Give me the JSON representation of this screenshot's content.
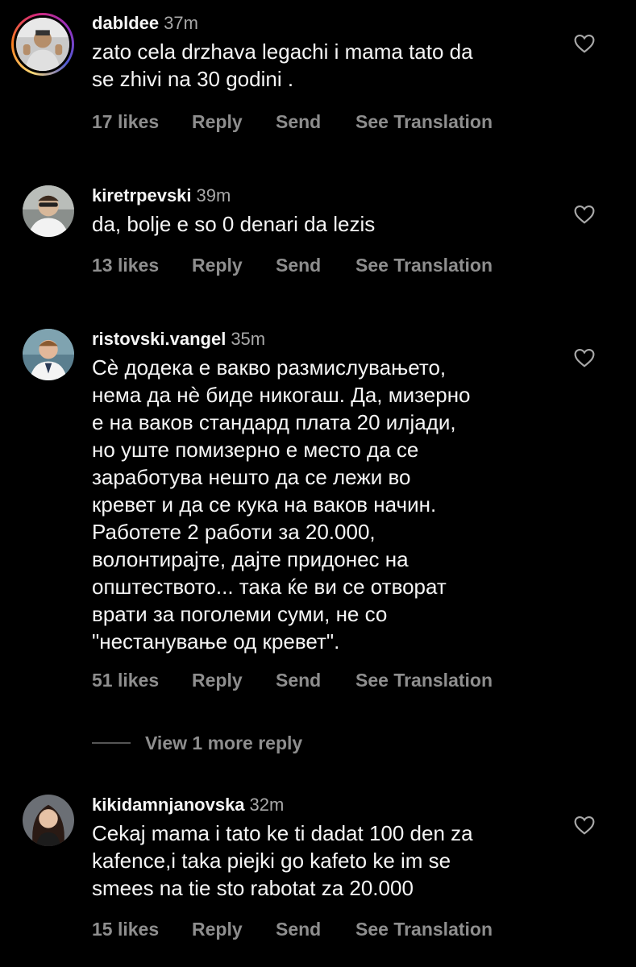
{
  "comments": [
    {
      "username": "dabldee",
      "time": "37m",
      "text": "zato cela drzhava legachi i mama tato da\nse zhivi na 30 godini .",
      "likes": "17 likes",
      "reply": "Reply",
      "send": "Send",
      "translate": "See Translation",
      "has_story": true
    },
    {
      "username": "kiretrpevski",
      "time": "39m",
      "text": "da, bolje e so 0 denari da lezis",
      "likes": "13 likes",
      "reply": "Reply",
      "send": "Send",
      "translate": "See Translation",
      "has_story": false
    },
    {
      "username": "ristovski.vangel",
      "time": "35m",
      "text": "Сѐ додека е вакво размислувањето,\nнема да нѐ биде никогаш. Да, мизерно\nе на ваков стандард плата 20 илјади,\nно уште помизерно е место да се\nзаработува нешто да се лежи во\nкревет и да се кука на ваков начин.\nРаботете 2 работи за 20.000,\nволонтирајте, дајте придонес на\nопштеството... така ќе ви се отворат\nврати за поголеми суми, не со\n\"нестанување од кревет\".",
      "likes": "51 likes",
      "reply": "Reply",
      "send": "Send",
      "translate": "See Translation",
      "has_story": false
    },
    {
      "username": "kikidamnjanovska",
      "time": "32m",
      "text": "Cekaj mama i tato ke ti dadat 100 den za\nkafence,i taka piejki go kafeto ke im se\nsmees na tie sto rabotat za 20.000",
      "likes": "15 likes",
      "reply": "Reply",
      "send": "Send",
      "translate": "See Translation",
      "has_story": false
    }
  ],
  "view_more_replies": "View 1 more reply",
  "icons": {
    "like": "heart-outline-icon"
  },
  "colors": {
    "background": "#000000",
    "text_primary": "#f5f5f5",
    "text_secondary": "#8e8e8e",
    "story_ring": [
      "#feda75",
      "#fa7e1e",
      "#d62976",
      "#962fbf",
      "#4f5bd5"
    ]
  }
}
